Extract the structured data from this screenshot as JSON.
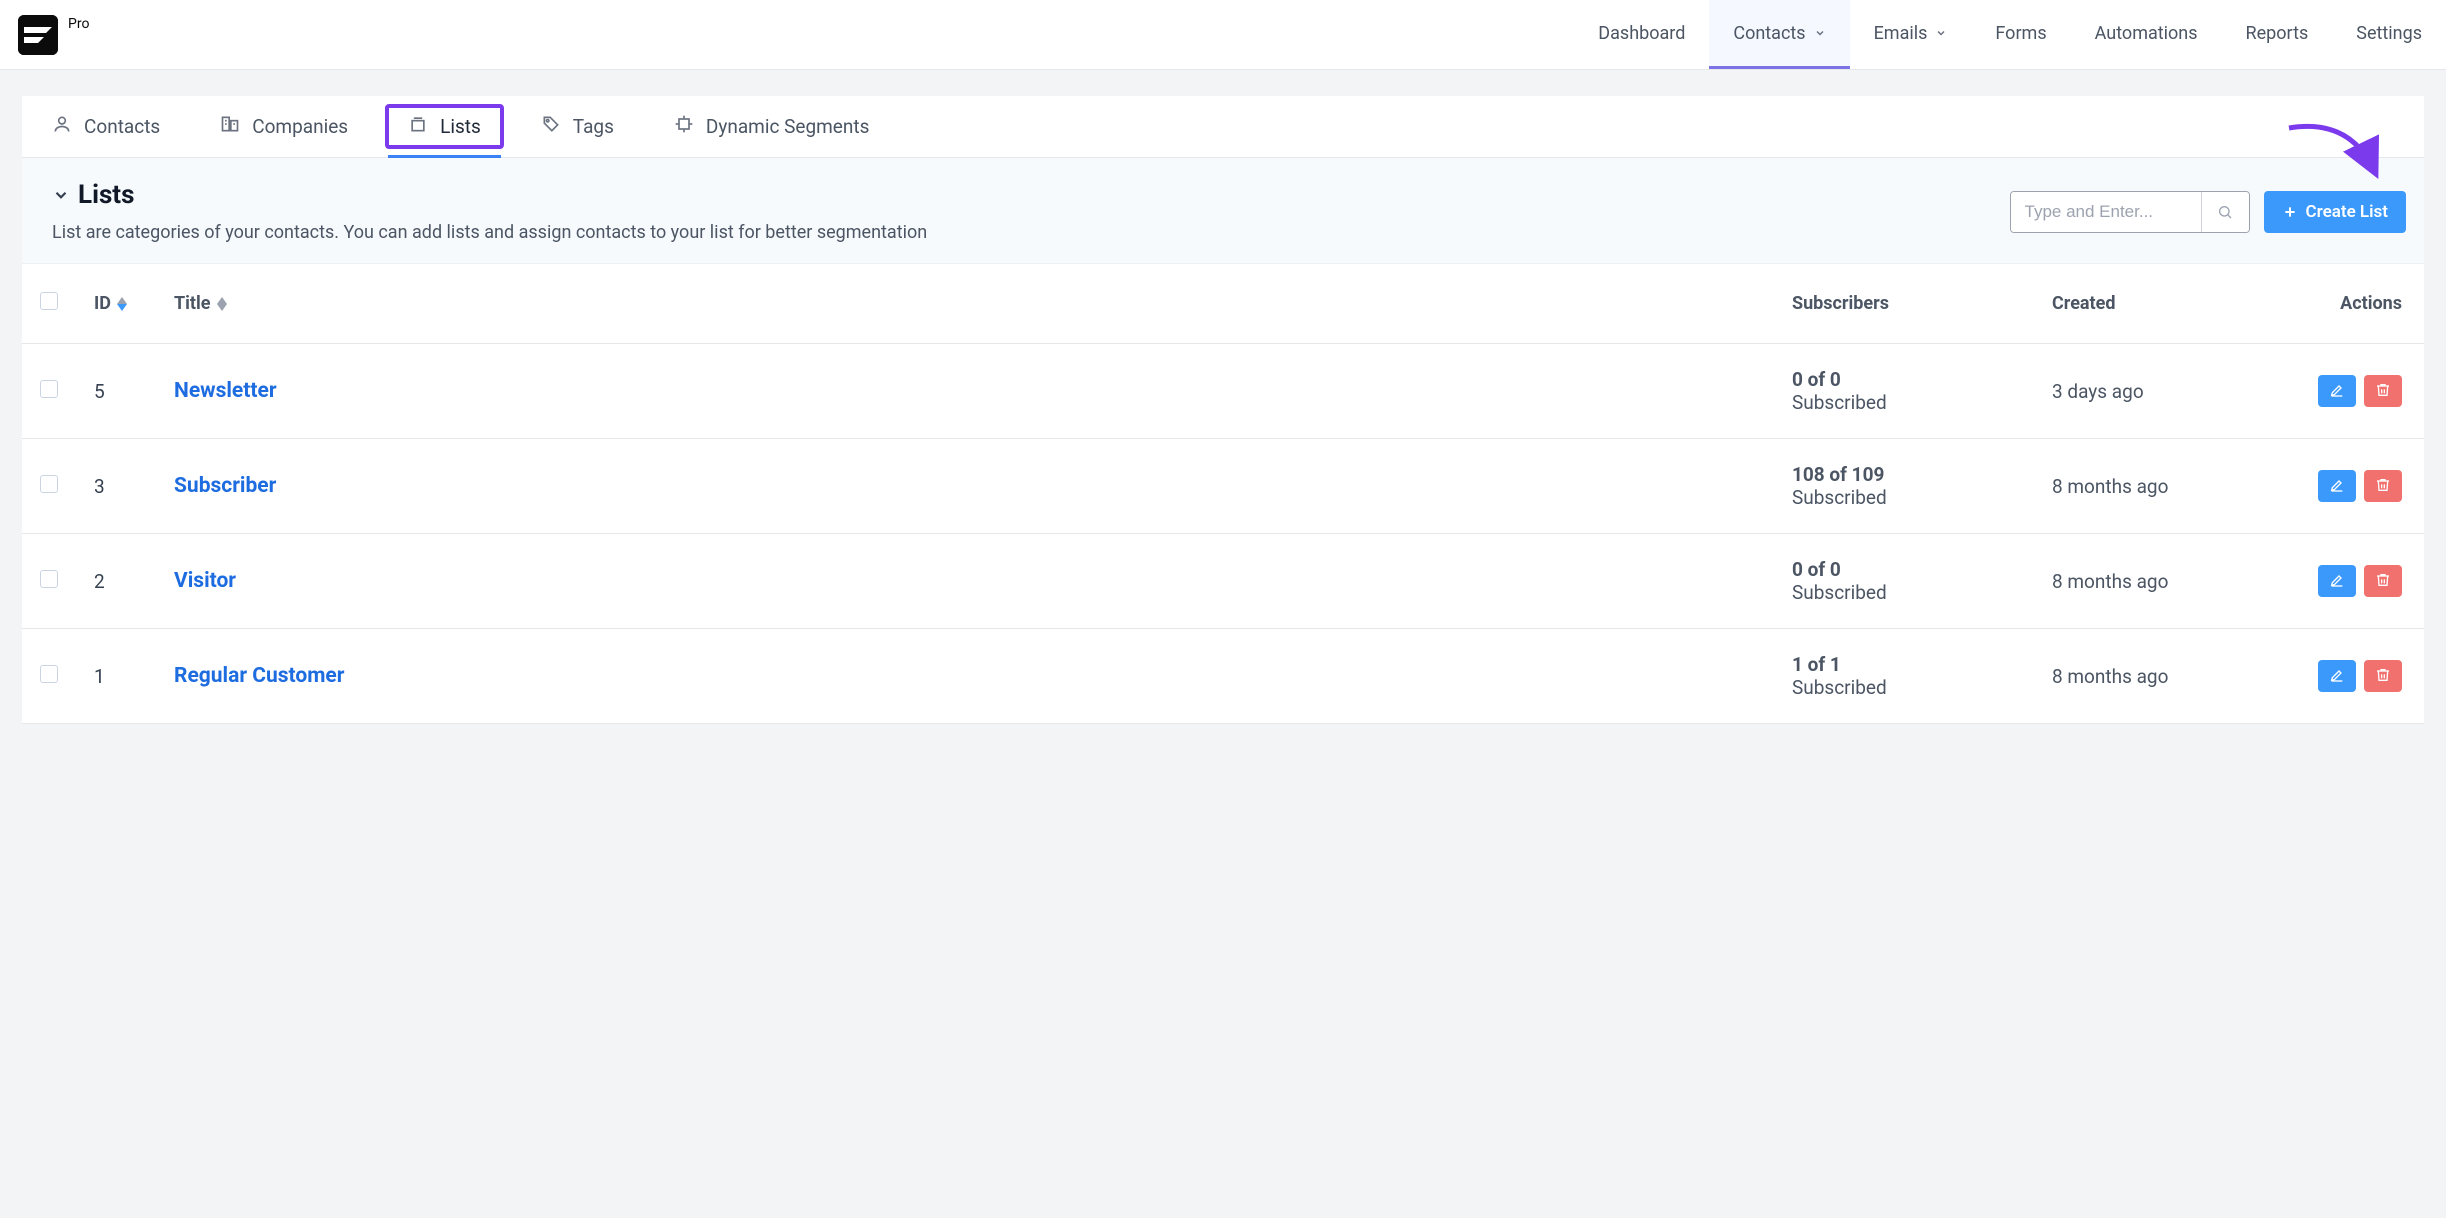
{
  "brand": {
    "pro_label": "Pro"
  },
  "topnav": {
    "items": [
      {
        "label": "Dashboard",
        "has_dropdown": false
      },
      {
        "label": "Contacts",
        "has_dropdown": true,
        "active": true
      },
      {
        "label": "Emails",
        "has_dropdown": true
      },
      {
        "label": "Forms",
        "has_dropdown": false
      },
      {
        "label": "Automations",
        "has_dropdown": false
      },
      {
        "label": "Reports",
        "has_dropdown": false
      },
      {
        "label": "Settings",
        "has_dropdown": false
      }
    ]
  },
  "subnav": {
    "items": [
      {
        "label": "Contacts",
        "name": "contacts-tab"
      },
      {
        "label": "Companies",
        "name": "companies-tab"
      },
      {
        "label": "Lists",
        "name": "lists-tab",
        "active": true
      },
      {
        "label": "Tags",
        "name": "tags-tab"
      },
      {
        "label": "Dynamic Segments",
        "name": "dynamic-segments-tab"
      }
    ]
  },
  "page": {
    "title": "Lists",
    "description": "List are categories of your contacts. You can add lists and assign contacts to your list for better segmentation"
  },
  "search": {
    "placeholder": "Type and Enter..."
  },
  "create_button": {
    "label": "Create List"
  },
  "table": {
    "headers": {
      "id": "ID",
      "title": "Title",
      "subscribers": "Subscribers",
      "created": "Created",
      "actions": "Actions"
    },
    "rows": [
      {
        "id": "5",
        "title": "Newsletter",
        "sub_count": "0 of 0",
        "sub_label": "Subscribed",
        "created": "3 days ago"
      },
      {
        "id": "3",
        "title": "Subscriber",
        "sub_count": "108 of 109",
        "sub_label": "Subscribed",
        "created": "8 months ago"
      },
      {
        "id": "2",
        "title": "Visitor",
        "sub_count": "0 of 0",
        "sub_label": "Subscribed",
        "created": "8 months ago"
      },
      {
        "id": "1",
        "title": "Regular Customer",
        "sub_count": "1 of 1",
        "sub_label": "Subscribed",
        "created": "8 months ago"
      }
    ]
  }
}
